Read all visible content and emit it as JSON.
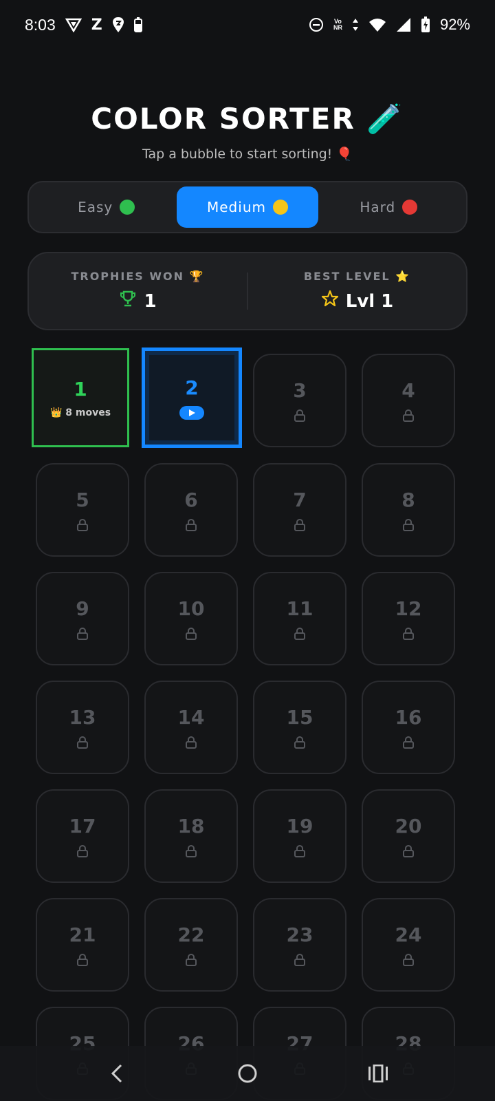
{
  "status_bar": {
    "time": "8:03",
    "battery_percent": "92%",
    "icons": [
      "vpn-shield-icon",
      "z-app-icon",
      "swiggy-icon",
      "battery-small-icon",
      "dnd-icon",
      "volte-icon",
      "data-arrows-icon",
      "wifi-icon",
      "signal-icon",
      "battery-charging-icon"
    ],
    "volte_line1": "Vo",
    "volte_line2": "NR"
  },
  "header": {
    "title": "COLOR SORTER 🧪",
    "subtitle": "Tap a bubble to start sorting! 🎈"
  },
  "difficulty_tabs": [
    {
      "label": "Easy",
      "color": "#2fbf4f",
      "active": false
    },
    {
      "label": "Medium",
      "color": "#f5c518",
      "active": true
    },
    {
      "label": "Hard",
      "color": "#e53935",
      "active": false
    }
  ],
  "stats": {
    "trophies_label": "TROPHIES WON 🏆",
    "trophies_value": "1",
    "best_label": "BEST LEVEL ⭐",
    "best_value": "Lvl 1"
  },
  "levels": [
    {
      "num": "1",
      "state": "done",
      "moves": "👑 8 moves"
    },
    {
      "num": "2",
      "state": "current"
    },
    {
      "num": "3",
      "state": "locked"
    },
    {
      "num": "4",
      "state": "locked"
    },
    {
      "num": "5",
      "state": "locked"
    },
    {
      "num": "6",
      "state": "locked"
    },
    {
      "num": "7",
      "state": "locked"
    },
    {
      "num": "8",
      "state": "locked"
    },
    {
      "num": "9",
      "state": "locked"
    },
    {
      "num": "10",
      "state": "locked"
    },
    {
      "num": "11",
      "state": "locked"
    },
    {
      "num": "12",
      "state": "locked"
    },
    {
      "num": "13",
      "state": "locked"
    },
    {
      "num": "14",
      "state": "locked"
    },
    {
      "num": "15",
      "state": "locked"
    },
    {
      "num": "16",
      "state": "locked"
    },
    {
      "num": "17",
      "state": "locked"
    },
    {
      "num": "18",
      "state": "locked"
    },
    {
      "num": "19",
      "state": "locked"
    },
    {
      "num": "20",
      "state": "locked"
    },
    {
      "num": "21",
      "state": "locked"
    },
    {
      "num": "22",
      "state": "locked"
    },
    {
      "num": "23",
      "state": "locked"
    },
    {
      "num": "24",
      "state": "locked"
    },
    {
      "num": "25",
      "state": "locked"
    },
    {
      "num": "26",
      "state": "locked"
    },
    {
      "num": "27",
      "state": "locked"
    },
    {
      "num": "28",
      "state": "locked"
    }
  ],
  "colors": {
    "accent": "#1487ff",
    "success": "#2fbf4f",
    "star": "#f5c518"
  },
  "nav": {
    "icons": [
      "back-icon",
      "home-icon",
      "recents-icon"
    ]
  }
}
